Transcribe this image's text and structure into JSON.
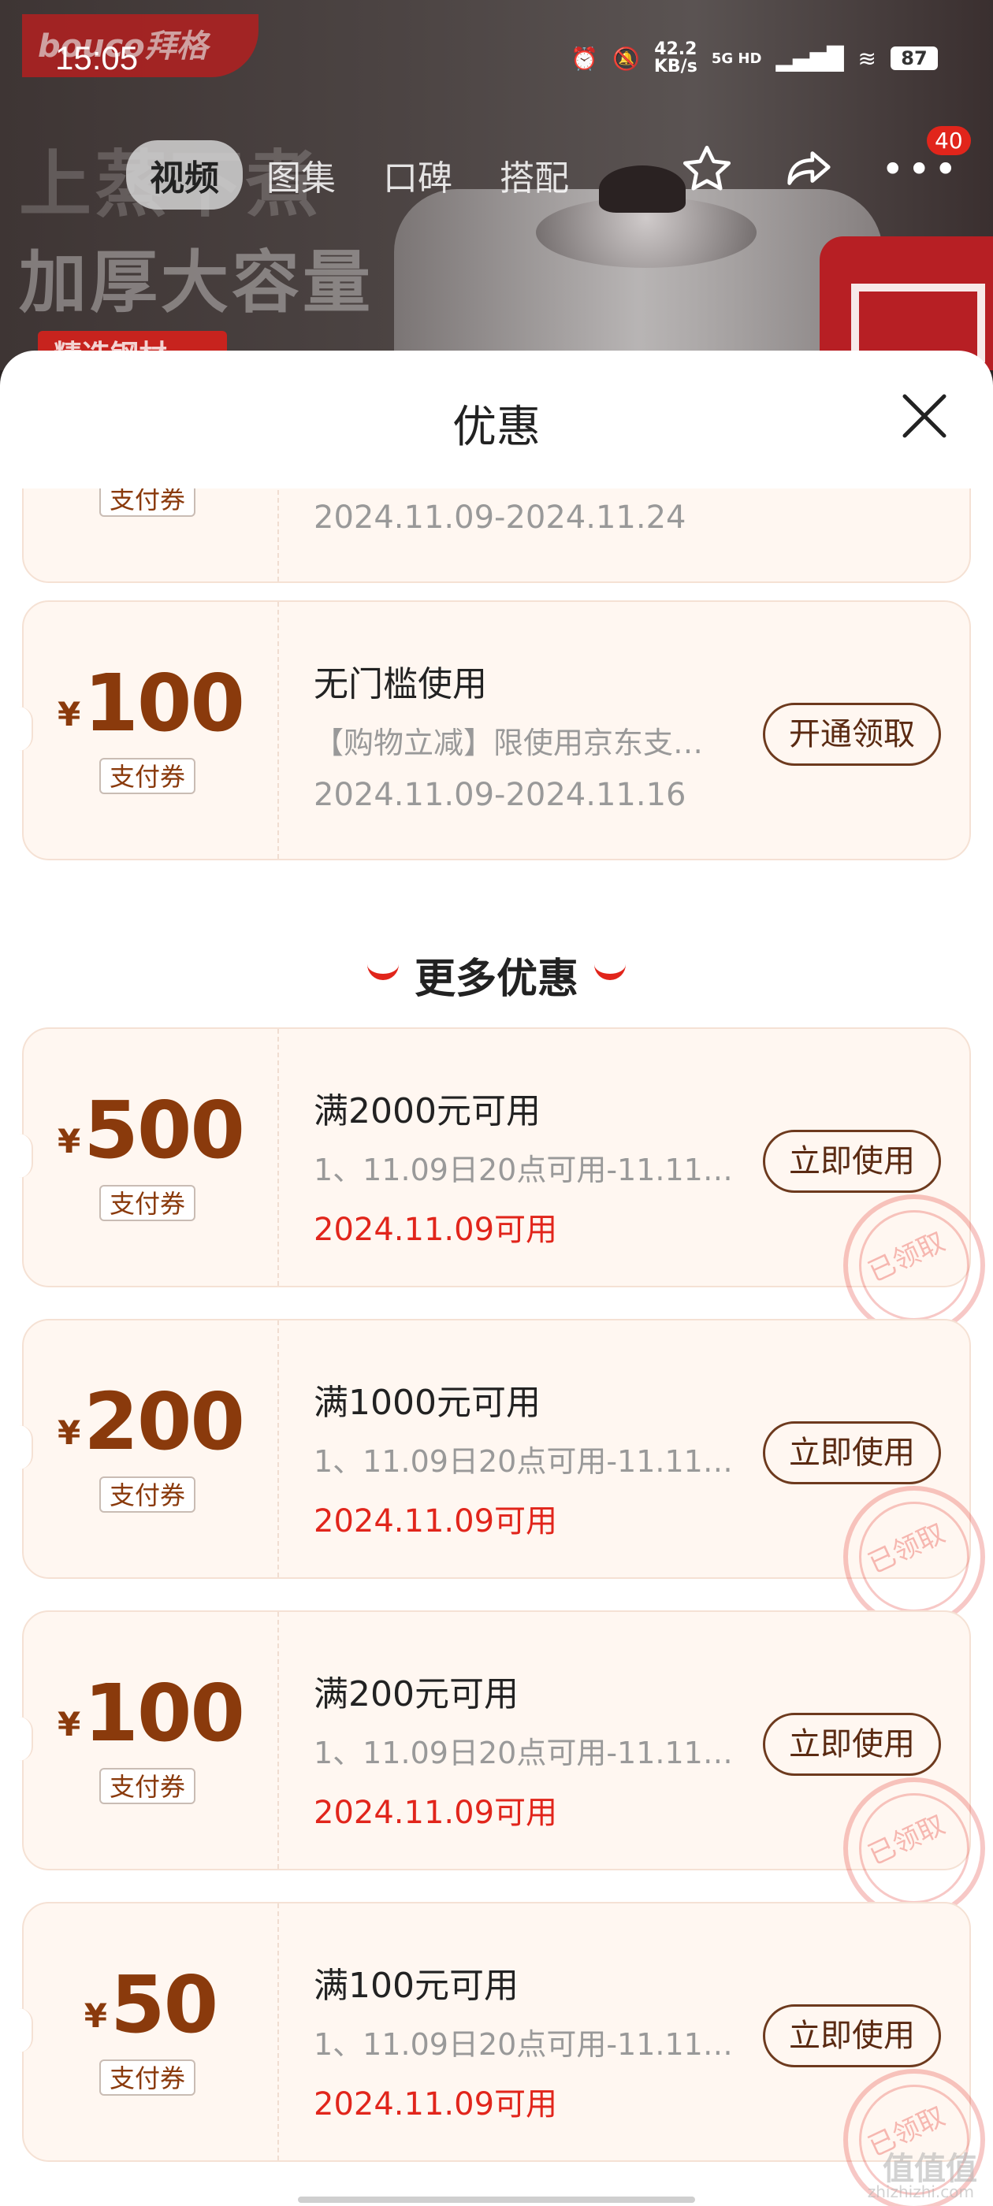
{
  "status_bar": {
    "time": "15:05",
    "speed_top": "42.2",
    "speed_unit": "KB/s",
    "network": "5G HD",
    "battery": "87"
  },
  "hero": {
    "brand": "bouco拜格",
    "bg_text_1": "上蒸下煮",
    "bg_text_2": "加厚大容量",
    "bg_text_3": "精选钢材"
  },
  "nav": {
    "tabs": [
      "视频",
      "图集",
      "口碑",
      "搭配"
    ],
    "active_tab": 0,
    "badge": "40"
  },
  "sheet": {
    "title": "优惠",
    "section_title": "更多优惠"
  },
  "coupons_top": [
    {
      "kind": "支付券",
      "date": "2024.11.09-2024.11.24"
    },
    {
      "yen": "¥",
      "amount": "100",
      "kind": "支付券",
      "name": "无门槛使用",
      "desc": "【购物立减】限使用京东支…",
      "date": "2024.11.09-2024.11.16",
      "button": "开通领取"
    }
  ],
  "coupons_more": [
    {
      "yen": "¥",
      "amount": "500",
      "kind": "支付券",
      "name": "满2000元可用",
      "desc": "1、11.09日20点可用-11.11…",
      "date": "2024.11.09可用",
      "button": "立即使用",
      "stamp": "已领取"
    },
    {
      "yen": "¥",
      "amount": "200",
      "kind": "支付券",
      "name": "满1000元可用",
      "desc": "1、11.09日20点可用-11.11…",
      "date": "2024.11.09可用",
      "button": "立即使用",
      "stamp": "已领取"
    },
    {
      "yen": "¥",
      "amount": "100",
      "kind": "支付券",
      "name": "满200元可用",
      "desc": "1、11.09日20点可用-11.11…",
      "date": "2024.11.09可用",
      "button": "立即使用",
      "stamp": "已领取"
    },
    {
      "yen": "¥",
      "amount": "50",
      "kind": "支付券",
      "name": "满100元可用",
      "desc": "1、11.09日20点可用-11.11…",
      "date": "2024.11.09可用",
      "button": "立即使用",
      "stamp": "已领取"
    }
  ],
  "watermark": {
    "logo": "值值值",
    "site": "zhizhizhi.com"
  },
  "colors": {
    "accent_red": "#e1251b",
    "coupon_brown": "#8a3a0c",
    "card_bg": "#fff7f1"
  }
}
